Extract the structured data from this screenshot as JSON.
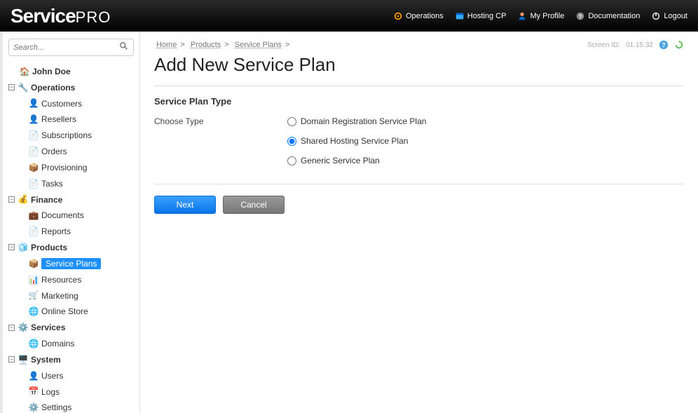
{
  "brand": {
    "part1": "Service",
    "part2": "PRO"
  },
  "topnav": {
    "operations": "Operations",
    "hosting_cp": "Hosting CP",
    "my_profile": "My Profile",
    "documentation": "Documentation",
    "logout": "Logout"
  },
  "search": {
    "placeholder": "Search..."
  },
  "sidebar": {
    "user": "John Doe",
    "operations": {
      "label": "Operations",
      "items": [
        "Customers",
        "Resellers",
        "Subscriptions",
        "Orders",
        "Provisioning",
        "Tasks"
      ]
    },
    "finance": {
      "label": "Finance",
      "items": [
        "Documents",
        "Reports"
      ]
    },
    "products": {
      "label": "Products",
      "items": [
        "Service Plans",
        "Resources",
        "Marketing",
        "Online Store"
      ]
    },
    "services": {
      "label": "Services",
      "items": [
        "Domains"
      ]
    },
    "system": {
      "label": "System",
      "items": [
        "Users",
        "Logs",
        "Settings"
      ]
    }
  },
  "breadcrumb": {
    "home": "Home",
    "products": "Products",
    "service_plans": "Service Plans",
    "screen_id_label": "Screen ID:",
    "screen_id": "01.15.32"
  },
  "page": {
    "title": "Add New Service Plan",
    "section_title": "Service Plan Type",
    "choose_type": "Choose Type",
    "options": {
      "domain_reg": "Domain Registration Service Plan",
      "shared_hosting": "Shared Hosting Service Plan",
      "generic": "Generic Service Plan"
    },
    "selected": "shared_hosting",
    "next": "Next",
    "cancel": "Cancel"
  }
}
